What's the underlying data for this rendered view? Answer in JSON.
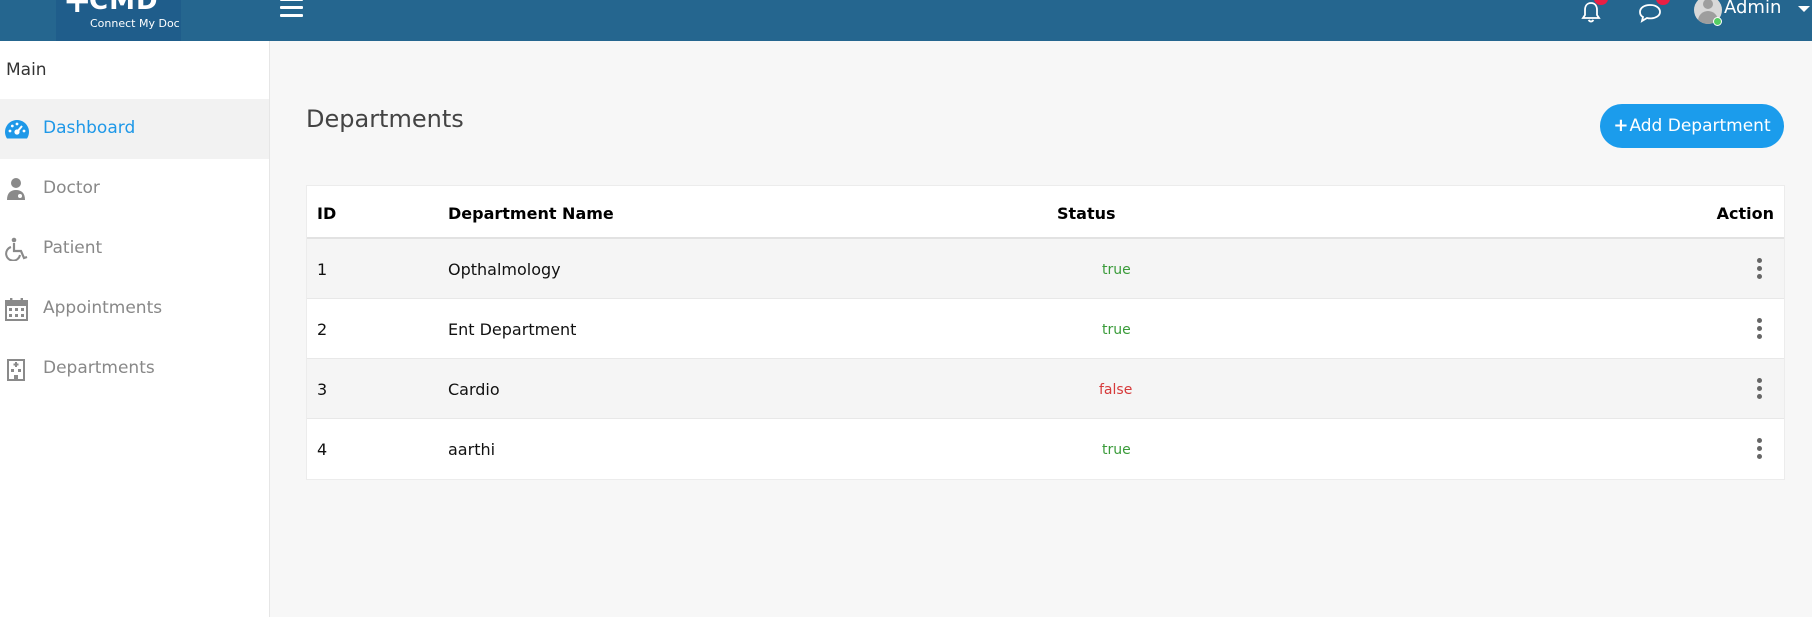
{
  "header": {
    "logo_mark": "+",
    "logo_title": "CMD",
    "logo_subtitle": "Connect My Doc",
    "menu_icon": "hamburger-icon",
    "notifications_icon": "bell-icon",
    "messages_icon": "chat-icon",
    "user_name": "Admin",
    "bg_color": "#25668f",
    "badge_color": "#ea1f44"
  },
  "sidebar": {
    "section_title": "Main",
    "items": [
      {
        "label": "Dashboard",
        "icon": "dashboard-icon",
        "active": true
      },
      {
        "label": "Doctor",
        "icon": "doctor-icon",
        "active": false
      },
      {
        "label": "Patient",
        "icon": "wheelchair-icon",
        "active": false
      },
      {
        "label": "Appointments",
        "icon": "calendar-icon",
        "active": false
      },
      {
        "label": "Departments",
        "icon": "hospital-icon",
        "active": false
      }
    ],
    "active_color": "#1e98e8"
  },
  "main": {
    "title": "Departments",
    "add_button": {
      "icon": "+",
      "label": "Add Department",
      "color": "#1b9cec"
    },
    "table": {
      "columns": [
        "ID",
        "Department Name",
        "Status",
        "Action"
      ],
      "rows": [
        {
          "id": "1",
          "name": "Opthalmology",
          "status": "true"
        },
        {
          "id": "2",
          "name": "Ent Department",
          "status": "true"
        },
        {
          "id": "3",
          "name": "Cardio",
          "status": "false"
        },
        {
          "id": "4",
          "name": "aarthi",
          "status": "true"
        }
      ],
      "action_icon": "kebab-menu-icon",
      "status_true_color": "#3a9b3a",
      "status_false_color": "#d63a3a"
    }
  }
}
